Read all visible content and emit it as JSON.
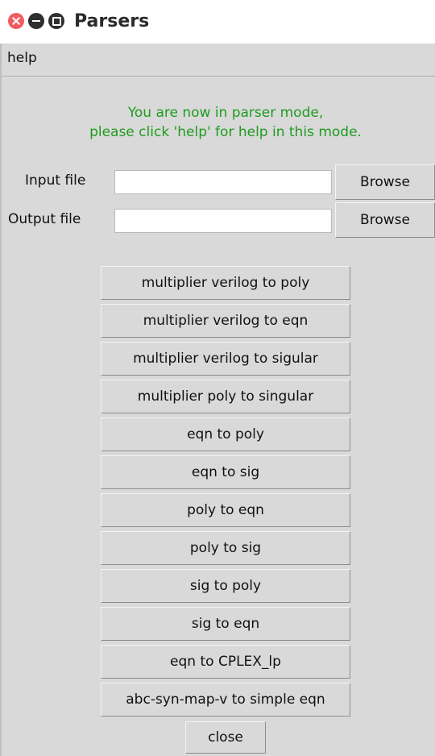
{
  "window": {
    "title": "Parsers"
  },
  "menu": {
    "help_label": "help"
  },
  "mode_message": {
    "line1": "You are now in parser mode,",
    "line2": "please click 'help' for help in this mode."
  },
  "input_file": {
    "label": "Input file",
    "value": "",
    "browse_label": "Browse"
  },
  "output_file": {
    "label": "Output file",
    "value": "",
    "browse_label": "Browse"
  },
  "parsers": [
    "multiplier verilog to poly",
    "multiplier verilog to eqn",
    "multiplier verilog to sigular",
    "multiplier poly to singular",
    "eqn to poly",
    "eqn to sig",
    "poly to eqn",
    "poly to sig",
    "sig to poly",
    "sig to eqn",
    "eqn to CPLEX_lp",
    "abc-syn-map-v to simple eqn"
  ],
  "close_label": "close",
  "colors": {
    "message": "#1e9c1e",
    "background": "#d9d9d9"
  }
}
